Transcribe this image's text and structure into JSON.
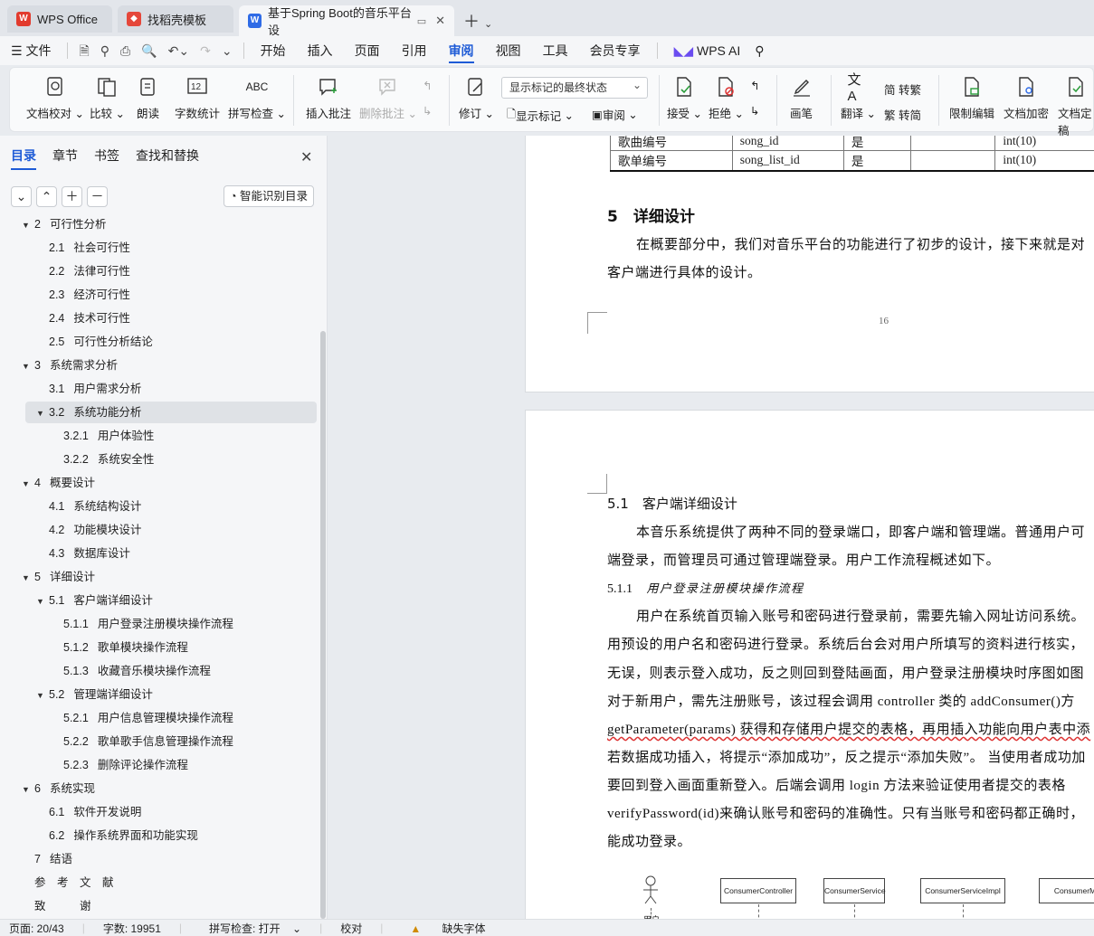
{
  "tabs": [
    {
      "label": "WPS Office"
    },
    {
      "label": "找稻壳模板"
    },
    {
      "label": "基于Spring Boot的音乐平台设"
    }
  ],
  "menu": {
    "file": "文件",
    "items": [
      "开始",
      "插入",
      "页面",
      "引用",
      "审阅",
      "视图",
      "工具",
      "会员专享"
    ],
    "ai": "WPS AI"
  },
  "ribbon": {
    "doc_proof": "文档校对",
    "compare": "比较",
    "read": "朗读",
    "word_count": "字数统计",
    "spell_check": "拼写检查",
    "insert_comment": "插入批注",
    "delete_comment": "删除批注",
    "track": "修订",
    "markup_combo": "显示标记的最终状态",
    "show_markup": "显示标记",
    "review": "审阅",
    "accept": "接受",
    "reject": "拒绝",
    "pen": "画笔",
    "translate": "翻译",
    "to_trad": "简 转繁",
    "to_simp": "繁 转简",
    "restrict": "限制编辑",
    "encrypt": "文档加密",
    "finalize": "文档定稿",
    "abc": "ABC",
    "num12": "12"
  },
  "sidebar": {
    "tabs": [
      "目录",
      "章节",
      "书签",
      "查找和替换"
    ],
    "smart_toc": "智能识别目录",
    "toc": [
      {
        "num": "2",
        "text": "可行性分析",
        "level": 0,
        "arrow": "▼"
      },
      {
        "num": "2.1",
        "text": "社会可行性",
        "level": 1
      },
      {
        "num": "2.2",
        "text": "法律可行性",
        "level": 1
      },
      {
        "num": "2.3",
        "text": "经济可行性",
        "level": 1
      },
      {
        "num": "2.4",
        "text": "技术可行性",
        "level": 1
      },
      {
        "num": "2.5",
        "text": "可行性分析结论",
        "level": 1
      },
      {
        "num": "3",
        "text": "系统需求分析",
        "level": 0,
        "arrow": "▼"
      },
      {
        "num": "3.1",
        "text": "用户需求分析",
        "level": 1
      },
      {
        "num": "3.2",
        "text": "系统功能分析",
        "level": 1,
        "arrow": "▼",
        "selected": true
      },
      {
        "num": "3.2.1",
        "text": "用户体验性",
        "level": 2
      },
      {
        "num": "3.2.2",
        "text": "系统安全性",
        "level": 2
      },
      {
        "num": "4",
        "text": "概要设计",
        "level": 0,
        "arrow": "▼"
      },
      {
        "num": "4.1",
        "text": "系统结构设计",
        "level": 1
      },
      {
        "num": "4.2",
        "text": "功能模块设计",
        "level": 1
      },
      {
        "num": "4.3",
        "text": "数据库设计",
        "level": 1
      },
      {
        "num": "5",
        "text": "详细设计",
        "level": 0,
        "arrow": "▼"
      },
      {
        "num": "5.1",
        "text": "客户端详细设计",
        "level": 1,
        "arrow": "▼"
      },
      {
        "num": "5.1.1",
        "text": "用户登录注册模块操作流程",
        "level": 2
      },
      {
        "num": "5.1.2",
        "text": "歌单模块操作流程",
        "level": 2
      },
      {
        "num": "5.1.3",
        "text": "收藏音乐模块操作流程",
        "level": 2
      },
      {
        "num": "5.2",
        "text": "管理端详细设计",
        "level": 1,
        "arrow": "▼"
      },
      {
        "num": "5.2.1",
        "text": "用户信息管理模块操作流程",
        "level": 2
      },
      {
        "num": "5.2.2",
        "text": "歌单歌手信息管理操作流程",
        "level": 2
      },
      {
        "num": "5.2.3",
        "text": "删除评论操作流程",
        "level": 2
      },
      {
        "num": "6",
        "text": "系统实现",
        "level": 0,
        "arrow": "▼"
      },
      {
        "num": "6.1",
        "text": "软件开发说明",
        "level": 1
      },
      {
        "num": "6.2",
        "text": "操作系统界面和功能实现",
        "level": 1
      },
      {
        "num": "7",
        "text": "结语",
        "level": 0
      },
      {
        "num": "",
        "text": "参　考　文　献",
        "level": 0
      },
      {
        "num": "",
        "text": "致　　　谢",
        "level": 0
      }
    ]
  },
  "document": {
    "table_rows": [
      [
        "歌曲编号",
        "song_id",
        "是",
        "",
        "int(10)"
      ],
      [
        "歌单编号",
        "song_list_id",
        "是",
        "",
        "int(10)"
      ]
    ],
    "h5": "5　详细设计",
    "p5_l1": "在概要部分中，我们对音乐平台的功能进行了初步的设计，接下来就是对",
    "p5_l2": "客户端进行具体的设计。",
    "page_no": "16",
    "h51": "5.1　客户端详细设计",
    "p51_l1": "本音乐系统提供了两种不同的登录端口，即客户端和管理端。普通用户可",
    "p51_l2": "端登录，而管理员可通过管理端登录。用户工作流程概述如下。",
    "h511_num": "5.1.1",
    "h511_text": "用户登录注册模块操作流程",
    "body": [
      "用户在系统首页输入账号和密码进行登录前，需要先输入网址访问系统。",
      "用预设的用户名和密码进行登录。系统后台会对用户所填写的资料进行核实，",
      "无误，则表示登入成功，反之则回到登陆画面，用户登录注册模块时序图如图",
      "对于新用户，需先注册账号，该过程会调用 controller 类的 addConsumer()方",
      "getParameter(params) 获得和存储用户提交的表格，再用插入功能向用户表中添",
      "若数据成功插入，将提示“添加成功”，反之提示“添加失败”。 当使用者成功加",
      "要回到登入画面重新登入。后端会调用 login 方法来验证使用者提交的表格",
      "verifyPassword(id)来确认账号和密码的准确性。只有当账号和密码都正确时，",
      "能成功登录。"
    ],
    "seq": [
      "ConsumerController",
      "ConsumerService",
      "ConsumerServiceImpl",
      "ConsumerM"
    ],
    "actor": "用户"
  },
  "status": {
    "page": "页面: 20/43",
    "words": "字数: 19951",
    "spell": "拼写检查: 打开",
    "proof": "校对",
    "missing_font": "缺失字体"
  }
}
